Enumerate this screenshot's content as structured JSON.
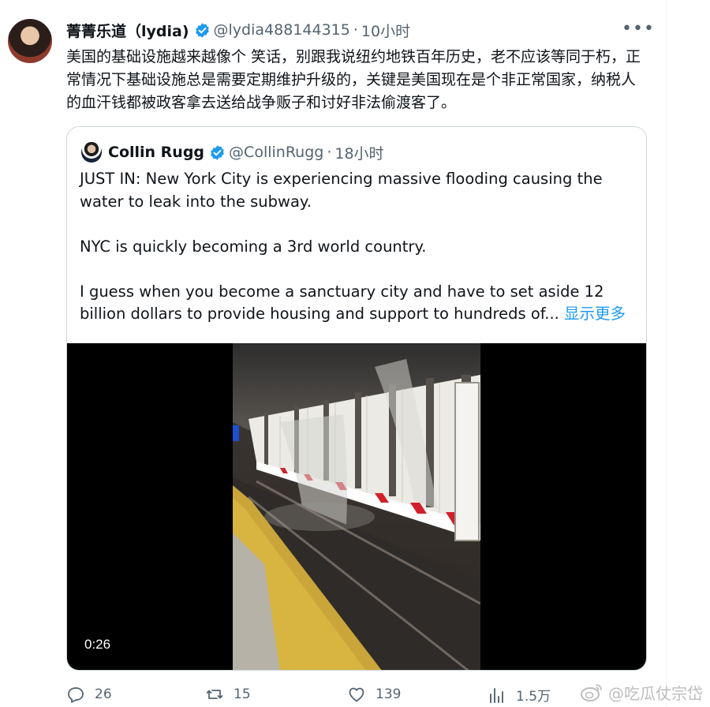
{
  "tweet": {
    "author_name": "菁菁乐道（lydia)",
    "author_handle": "@lydia488144315",
    "separator": "·",
    "time": "10小时",
    "more_label": "•••",
    "text": "美国的基础设施越来越像个 笑话，别跟我说纽约地铁百年历史，老不应该等同于朽，正常情况下基础设施总是需要定期维护升级的，关键是美国现在是个非正常国家，纳税人的血汗钱都被政客拿去送给战争贩子和讨好非法偷渡客了。"
  },
  "quote": {
    "author_name": "Collin Rugg",
    "author_handle": "@CollinRugg",
    "separator": "·",
    "time": "18小时",
    "paragraphs": [
      "JUST IN: New York City is experiencing massive flooding causing the water to leak into the subway.",
      "NYC is quickly becoming a 3rd world country.",
      "I guess when you become a sanctuary city and have to set aside 12 billion dollars to provide housing and support to hundreds of..."
    ],
    "show_more": "显示更多",
    "video": {
      "duration": "0:26"
    }
  },
  "actions": {
    "replies": "26",
    "retweets": "15",
    "likes": "139",
    "views": "1.5万"
  },
  "watermark": "@吃瓜仗宗岱",
  "colors": {
    "accent": "#1d9bf0",
    "muted": "#536471",
    "border": "#cfd9de",
    "tile_red": "#d2202a"
  },
  "icons": [
    "verified-badge-icon",
    "more-icon",
    "reply-icon",
    "retweet-icon",
    "like-icon",
    "views-icon",
    "weibo-icon"
  ]
}
